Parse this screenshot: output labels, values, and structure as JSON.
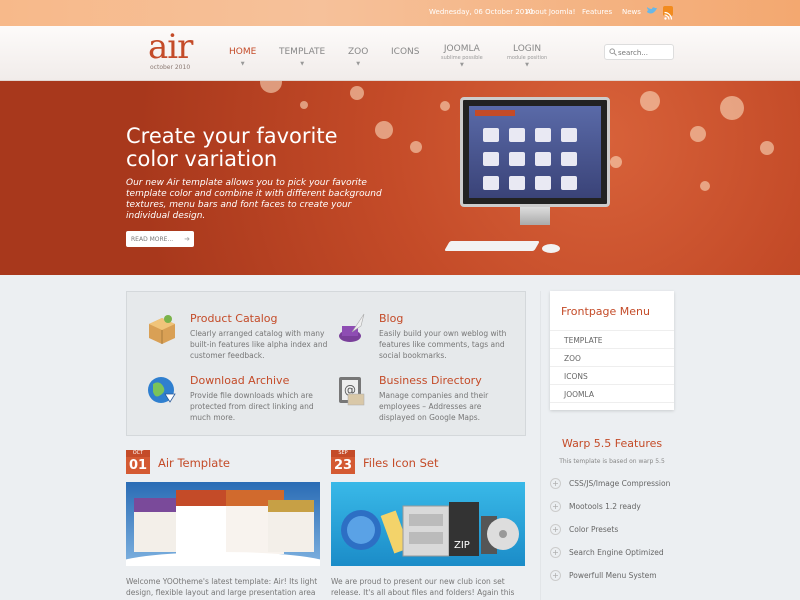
{
  "topbar": {
    "date": "Wednesday, 06 October 2010",
    "links": [
      "About Joomla!",
      "Features",
      "News"
    ]
  },
  "header": {
    "logo": "air",
    "logo_sub": "october 2010",
    "nav": [
      {
        "label": "HOME",
        "sub": ""
      },
      {
        "label": "TEMPLATE",
        "sub": ""
      },
      {
        "label": "ZOO",
        "sub": ""
      },
      {
        "label": "ICONS",
        "sub": ""
      },
      {
        "label": "JOOMLA",
        "sub": "sublime possible"
      },
      {
        "label": "LOGIN",
        "sub": "module position"
      }
    ],
    "search_placeholder": "search..."
  },
  "hero": {
    "title": "Create your favorite color variation",
    "text": "Our new Air template allows you to pick your favorite template color and combine it with different background textures, menu bars and font faces to create your individual design.",
    "button": "READ MORE..."
  },
  "features": [
    {
      "title": "Product Catalog",
      "text": "Clearly arranged catalog with many built-in features like alpha index and customer feedback.",
      "icon": "package-icon"
    },
    {
      "title": "Blog",
      "text": "Easily build your own weblog with features like comments, tags and social bookmarks.",
      "icon": "quill-ink-icon"
    },
    {
      "title": "Download Archive",
      "text": "Provide file downloads which are protected from direct linking and much more.",
      "icon": "globe-download-icon"
    },
    {
      "title": "Business Directory",
      "text": "Manage companies and their employees – Addresses are displayed on Google Maps.",
      "icon": "address-book-icon"
    }
  ],
  "articles": [
    {
      "month": "OCT",
      "day": "01",
      "title": "Air Template",
      "excerpt": "Welcome YOOtheme's latest template: Air! Its light design, flexible layout and large presentation area"
    },
    {
      "month": "SEP",
      "day": "23",
      "title": "Files Icon Set",
      "excerpt": "We are proud to present our new club icon set release. It's all about files and folders! Again this icon"
    }
  ],
  "sidebar": {
    "menu_title": "Frontpage Menu",
    "menu_items": [
      "TEMPLATE",
      "ZOO",
      "ICONS",
      "JOOMLA"
    ],
    "warp_title": "Warp 5.5 Features",
    "warp_note": "This template is based on warp 5.5",
    "warp_items": [
      "CSS/JS/Image Compression",
      "Mootools 1.2 ready",
      "Color Presets",
      "Search Engine Optimized",
      "Powerfull Menu System"
    ]
  },
  "colors": {
    "accent": "#c44b28",
    "hero": "#b8441f"
  }
}
